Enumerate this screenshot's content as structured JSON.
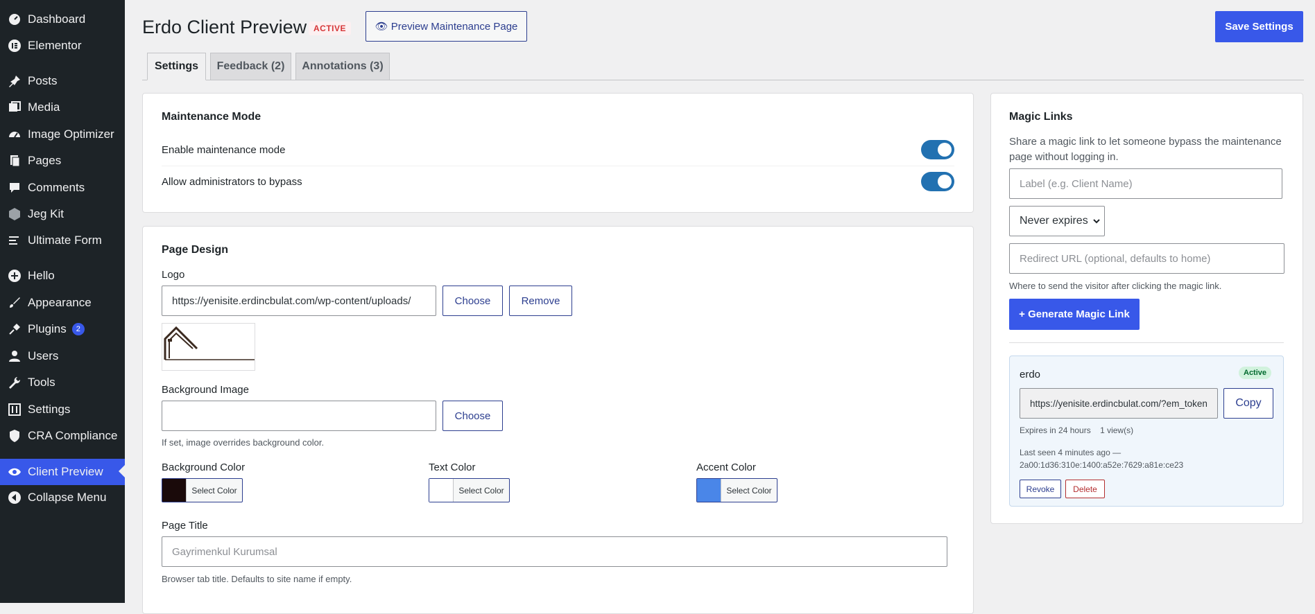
{
  "sidebar": {
    "items": [
      {
        "label": "Dashboard",
        "icon": "dashboard-icon"
      },
      {
        "label": "Elementor",
        "icon": "elementor-icon"
      },
      {
        "label": "Posts",
        "icon": "pin-icon"
      },
      {
        "label": "Media",
        "icon": "media-icon"
      },
      {
        "label": "Image Optimizer",
        "icon": "gauge-icon"
      },
      {
        "label": "Pages",
        "icon": "pages-icon"
      },
      {
        "label": "Comments",
        "icon": "comment-icon"
      },
      {
        "label": "Jeg Kit",
        "icon": "hexagon-icon"
      },
      {
        "label": "Ultimate Form",
        "icon": "form-icon"
      },
      {
        "label": "Hello",
        "icon": "plus-circle-icon"
      },
      {
        "label": "Appearance",
        "icon": "brush-icon"
      },
      {
        "label": "Plugins",
        "icon": "plug-icon",
        "badge": "2"
      },
      {
        "label": "Users",
        "icon": "user-icon"
      },
      {
        "label": "Tools",
        "icon": "wrench-icon"
      },
      {
        "label": "Settings",
        "icon": "sliders-icon"
      },
      {
        "label": "CRA Compliance",
        "icon": "shield-icon"
      },
      {
        "label": "Client Preview",
        "icon": "eye-icon"
      },
      {
        "label": "Collapse Menu",
        "icon": "collapse-icon"
      }
    ]
  },
  "header": {
    "title": "Erdo Client Preview",
    "status": "ACTIVE",
    "preview_button": "👁 Preview Maintenance Page",
    "save_button": "Save Settings"
  },
  "tabs": [
    {
      "label": "Settings"
    },
    {
      "label": "Feedback (2)"
    },
    {
      "label": "Annotations (3)"
    }
  ],
  "maintenance": {
    "title": "Maintenance Mode",
    "enable_label": "Enable maintenance mode",
    "bypass_label": "Allow administrators to bypass"
  },
  "design": {
    "title": "Page Design",
    "logo_label": "Logo",
    "logo_url": "https://yenisite.erdincbulat.com/wp-content/uploads/",
    "choose": "Choose",
    "remove": "Remove",
    "bg_image_label": "Background Image",
    "bg_image_hint": "If set, image overrides background color.",
    "bg_color_label": "Background Color",
    "text_color_label": "Text Color",
    "accent_color_label": "Accent Color",
    "select_color": "Select Color",
    "colors": {
      "background": "#1a0a0a",
      "text": "#ffffff",
      "accent": "#4a86e8"
    },
    "page_title_label": "Page Title",
    "page_title_placeholder": "Gayrimenkul Kurumsal",
    "page_title_hint": "Browser tab title. Defaults to site name if empty."
  },
  "magic": {
    "title": "Magic Links",
    "desc": "Share a magic link to let someone bypass the maintenance page without logging in.",
    "label_placeholder": "Label (e.g. Client Name)",
    "expires": "Never expires",
    "redirect_placeholder": "Redirect URL (optional, defaults to home)",
    "redirect_hint": "Where to send the visitor after clicking the magic link.",
    "generate_button": "+ Generate Magic Link",
    "link": {
      "name": "erdo",
      "status": "Active",
      "url": "https://yenisite.erdincbulat.com/?em_token",
      "copy": "Copy",
      "expires": "Expires in 24 hours",
      "views": "1 view(s)",
      "last_seen": "Last seen 4 minutes ago —",
      "ip": "2a00:1d36:310e:1400:a52e:7629:a81e:ce23",
      "revoke": "Revoke",
      "delete": "Delete"
    }
  }
}
